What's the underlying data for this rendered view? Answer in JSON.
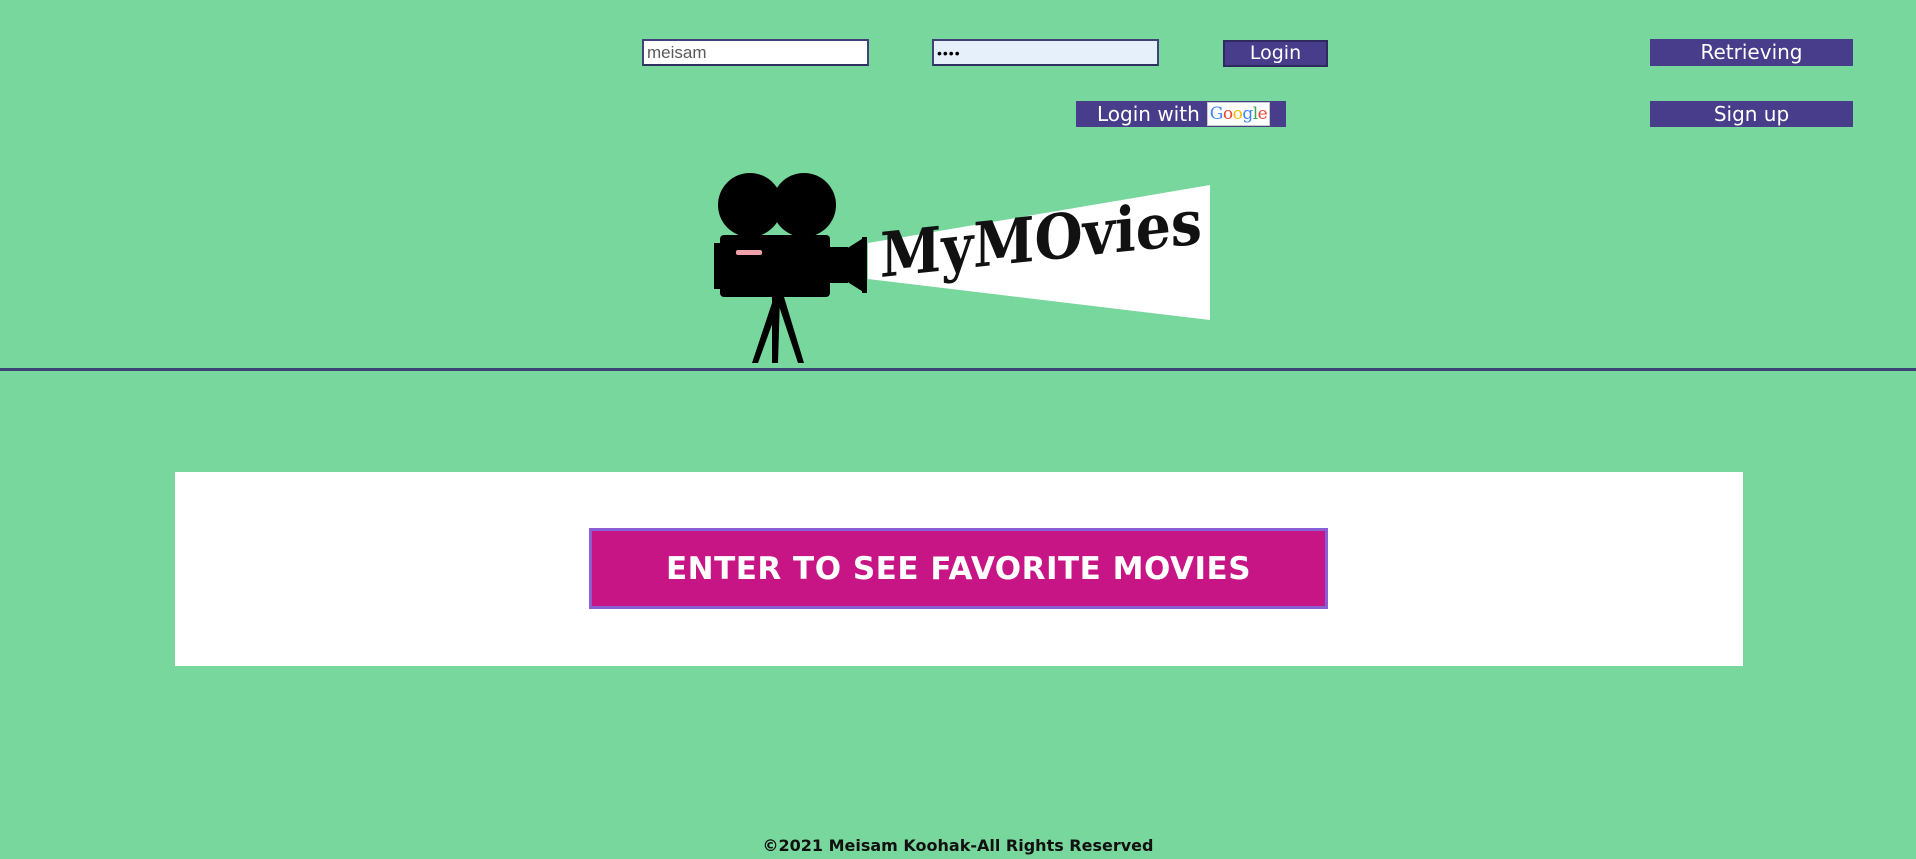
{
  "login_form": {
    "username_value": "meisam",
    "password_value": "••••",
    "login_label": "Login"
  },
  "header_buttons": {
    "retrieving_label": "Retrieving",
    "signup_label": "Sign up",
    "google_prefix": "Login with",
    "google_word": "Google"
  },
  "logo": {
    "text": "MyMOvies"
  },
  "main": {
    "enter_label": "ENTER TO SEE FAVORITE MOVIES"
  },
  "footer": {
    "text": "©2021 Meisam Koohak-All Rights Reserved"
  },
  "colors": {
    "background": "#77d79c",
    "button": "#483d8b",
    "enter_button": "#c71585",
    "enter_border": "#8a5fd6",
    "divider": "#3d4375",
    "panel": "#ffffff"
  }
}
